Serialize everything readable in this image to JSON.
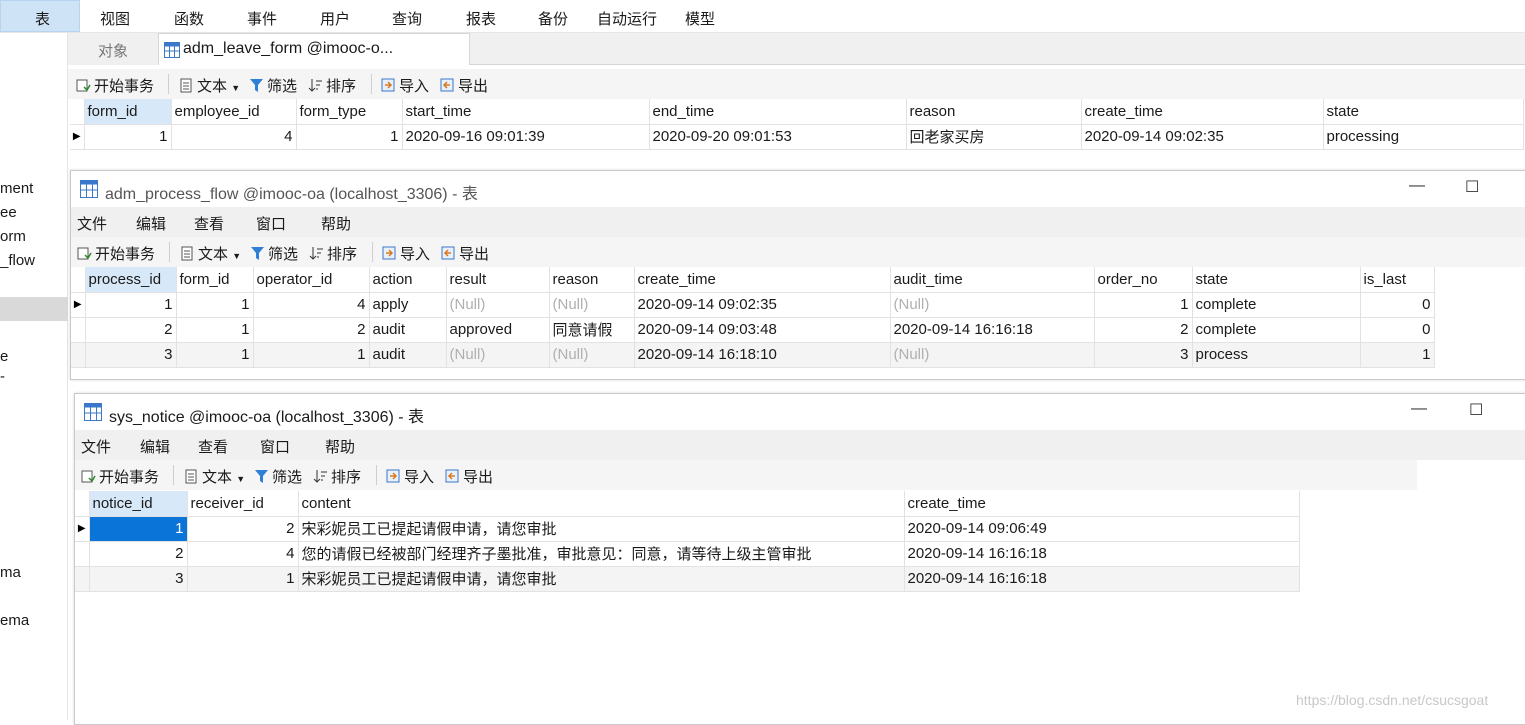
{
  "top_menu": [
    "表",
    "视图",
    "函数",
    "事件",
    "用户",
    "查询",
    "报表",
    "备份",
    "自动运行",
    "模型"
  ],
  "sidebar": [
    "ment",
    "ee",
    "orm",
    "_flow",
    "e",
    "-",
    "ma",
    "ema"
  ],
  "tabs": {
    "objects": "对象",
    "current": "adm_leave_form @imooc-o..."
  },
  "toolbar": {
    "begin": "开始事务",
    "text": "文本",
    "filter": "筛选",
    "sort": "排序",
    "import": "导入",
    "export": "导出"
  },
  "leave_form": {
    "columns": [
      "form_id",
      "employee_id",
      "form_type",
      "start_time",
      "end_time",
      "reason",
      "create_time",
      "state"
    ],
    "rows": [
      [
        "1",
        "4",
        "1",
        "2020-09-16 09:01:39",
        "2020-09-20 09:01:53",
        "回老家买房",
        "2020-09-14 09:02:35",
        "processing"
      ]
    ]
  },
  "process_flow_window": {
    "title": "adm_process_flow @imooc-oa (localhost_3306) - 表",
    "menu": [
      "文件",
      "编辑",
      "查看",
      "窗口",
      "帮助"
    ],
    "columns": [
      "process_id",
      "form_id",
      "operator_id",
      "action",
      "result",
      "reason",
      "create_time",
      "audit_time",
      "order_no",
      "state",
      "is_last"
    ],
    "rows": [
      [
        "1",
        "1",
        "4",
        "apply",
        "(Null)",
        "(Null)",
        "2020-09-14 09:02:35",
        "(Null)",
        "1",
        "complete",
        "0"
      ],
      [
        "2",
        "1",
        "2",
        "audit",
        "approved",
        "同意请假",
        "2020-09-14 09:03:48",
        "2020-09-14 16:16:18",
        "2",
        "complete",
        "0"
      ],
      [
        "3",
        "1",
        "1",
        "audit",
        "(Null)",
        "(Null)",
        "2020-09-14 16:18:10",
        "(Null)",
        "3",
        "process",
        "1"
      ]
    ]
  },
  "notice_window": {
    "title": "sys_notice @imooc-oa (localhost_3306) - 表",
    "menu": [
      "文件",
      "编辑",
      "查看",
      "窗口",
      "帮助"
    ],
    "columns": [
      "notice_id",
      "receiver_id",
      "content",
      "create_time"
    ],
    "rows": [
      [
        "1",
        "2",
        "宋彩妮员工已提起请假申请，请您审批",
        "2020-09-14 09:06:49"
      ],
      [
        "2",
        "4",
        "您的请假已经被部门经理齐子墨批准，审批意见：同意，请等待上级主管审批",
        "2020-09-14 16:16:18"
      ],
      [
        "3",
        "1",
        "宋彩妮员工已提起请假申请，请您审批",
        "2020-09-14 16:16:18"
      ]
    ]
  },
  "watermark": "https://blog.csdn.net/csucsgoat",
  "colors": {
    "selected_cell": "#0b74d9",
    "header_highlight": "#d7e8f8",
    "null_text": "#b0b0b0"
  }
}
